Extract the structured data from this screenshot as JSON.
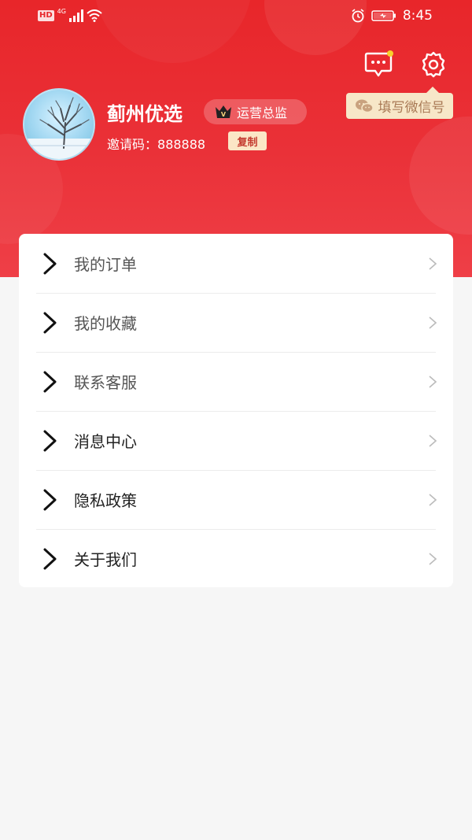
{
  "status_bar": {
    "hd": "HD",
    "network": "4G",
    "time": "8:45"
  },
  "header": {
    "tooltip": "填写微信号",
    "user_name": "蓟州优选",
    "role": "运营总监",
    "role_icon_letter": "V",
    "invite_label": "邀请码：",
    "invite_code": "888888",
    "copy_label": "复制",
    "accent_color": "#e8262a",
    "notification_dot_color": "#f9d02b"
  },
  "menu": {
    "items": [
      {
        "label": "我的订单",
        "icon": "chevron-right-icon"
      },
      {
        "label": "我的收藏",
        "icon": "chevron-right-icon"
      },
      {
        "label": "联系客服",
        "icon": "chevron-right-icon"
      },
      {
        "label": "消息中心",
        "icon": "chevron-right-icon"
      },
      {
        "label": "隐私政策",
        "icon": "chevron-right-icon"
      },
      {
        "label": "关于我们",
        "icon": "chevron-right-icon"
      }
    ]
  }
}
